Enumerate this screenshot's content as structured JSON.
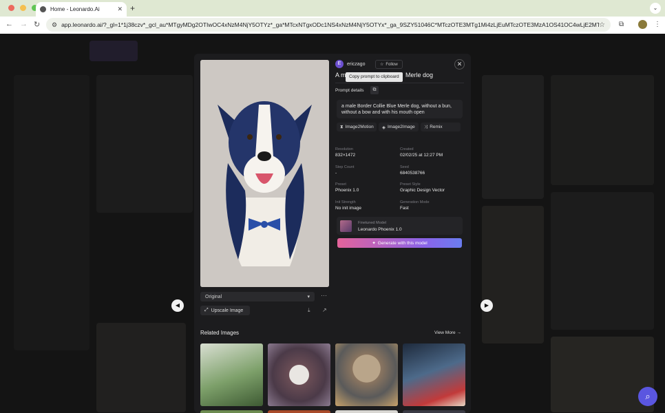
{
  "browser": {
    "tab_title": "Home - Leonardo.Ai",
    "url": "app.leonardo.ai/?_gl=1*1j38czv*_gcl_au*MTgyMDg2OTIwOC4xNzM4NjY5OTYz*_ga*MTcxNTgxODc1NS4xNzM4NjY5OTYx*_ga_9SZY51046C*MTczOTE3MTg1Mi4zLjEuMTczOTE3MzA1OS41OC4wLjE2MTUx..."
  },
  "creator": {
    "avatar_letter": "E",
    "name": "ericzago",
    "follow_label": "Follow"
  },
  "prompt_title_start": "A m",
  "prompt_title_end": "Merle dog",
  "tooltip": "Copy prompt to clipboard",
  "prompt_details_label": "Prompt details",
  "prompt_text": "a male Border Collie Blue Merle dog, without a bun, without a bow and with his mouth open",
  "actions": {
    "image2motion": "Image2Motion",
    "image2image": "Image2Image",
    "remix": "Remix"
  },
  "meta": {
    "resolution_label": "Resolution",
    "resolution": "832×1472",
    "created_label": "Created",
    "created": "02/02/25 at 12:27 PM",
    "step_count_label": "Step Count",
    "step_count": "-",
    "seed_label": "Seed",
    "seed": "6840538766",
    "preset_label": "Preset",
    "preset": "Phoenix 1.0",
    "preset_style_label": "Preset Style",
    "preset_style": "Graphic Design Vector",
    "init_strength_label": "Init Strength",
    "init_strength": "No init image",
    "generation_mode_label": "Generation Mode",
    "generation_mode": "Fast"
  },
  "model": {
    "label": "Finetuned Model",
    "name": "Leonardo Phoenix 1.0",
    "generate_label": "Generate with this model"
  },
  "variant": {
    "selected": "Original"
  },
  "upscale_label": "Upscale Image",
  "related": {
    "title": "Related Images",
    "view_more": "View More"
  },
  "colors": {
    "accent_start": "#e4639a",
    "accent_end": "#6a7df0",
    "fab": "#5a56e0"
  }
}
